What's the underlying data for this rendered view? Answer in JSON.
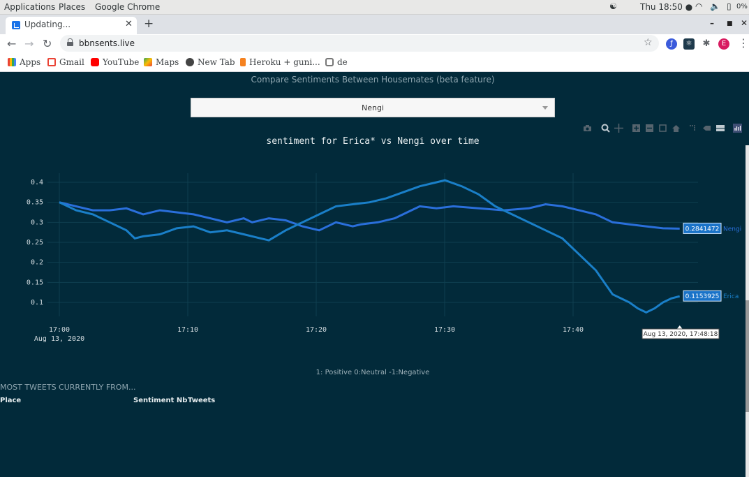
{
  "desktop": {
    "menus": [
      "Applications",
      "Places",
      "Google Chrome"
    ],
    "clock": "Thu 18:50 ●",
    "battery": "0%"
  },
  "browser": {
    "tab_title": "Updating...",
    "url": "bbnsents.live",
    "profile_initial": "E",
    "bookmarks": [
      "Apps",
      "Gmail",
      "YouTube",
      "Maps",
      "New Tab",
      "Heroku + guni...",
      "de"
    ]
  },
  "page": {
    "heading": "Compare Sentiments Between Housemates (beta feature)",
    "dropdown_value": "Nengi",
    "legend_note": "1: Positive 0:Neutral -1:Negative",
    "most_tweets_label": "MOST TWEETS CURRENTLY FROM...",
    "table_headers": [
      "Place",
      "Sentiment Nb",
      "Tweets"
    ]
  },
  "chart_data": {
    "type": "line",
    "title": "sentiment for Erica* vs Nengi over time",
    "xlabel": "",
    "ylabel": "",
    "x_ticks": [
      "17:00",
      "17:10",
      "17:20",
      "17:30",
      "17:40"
    ],
    "x_date_label": "Aug 13, 2020",
    "y_ticks": [
      "0.1",
      "0.15",
      "0.2",
      "0.25",
      "0.3",
      "0.35",
      "0.4"
    ],
    "ylim": [
      0.065,
      0.415
    ],
    "xlim_minutes": [
      0,
      50
    ],
    "series": [
      {
        "name": "Nengi",
        "color": "#2a6fdb",
        "end_label": "0.2841472",
        "points": [
          [
            0,
            0.35
          ],
          [
            2,
            0.34
          ],
          [
            4,
            0.33
          ],
          [
            6,
            0.33
          ],
          [
            8,
            0.335
          ],
          [
            10,
            0.32
          ],
          [
            12,
            0.33
          ],
          [
            14,
            0.325
          ],
          [
            16,
            0.32
          ],
          [
            18,
            0.31
          ],
          [
            19,
            0.305
          ],
          [
            20,
            0.3
          ],
          [
            21,
            0.305
          ],
          [
            22,
            0.31
          ],
          [
            23,
            0.3
          ],
          [
            25,
            0.31
          ],
          [
            27,
            0.305
          ],
          [
            29,
            0.29
          ],
          [
            31,
            0.28
          ],
          [
            33,
            0.3
          ],
          [
            35,
            0.29
          ],
          [
            36,
            0.295
          ],
          [
            38,
            0.3
          ],
          [
            40,
            0.31
          ],
          [
            41,
            0.32
          ],
          [
            42,
            0.33
          ],
          [
            43,
            0.34
          ],
          [
            45,
            0.335
          ],
          [
            47,
            0.34
          ],
          [
            50,
            0.335
          ],
          [
            53,
            0.33
          ],
          [
            56,
            0.335
          ],
          [
            58,
            0.345
          ],
          [
            60,
            0.34
          ],
          [
            62,
            0.33
          ],
          [
            64,
            0.32
          ],
          [
            66,
            0.3
          ],
          [
            68,
            0.295
          ],
          [
            70,
            0.29
          ],
          [
            72,
            0.285
          ],
          [
            74,
            0.2841472
          ]
        ]
      },
      {
        "name": "Erica",
        "color": "#1a7fc8",
        "end_label": "0.1153925",
        "points": [
          [
            0,
            0.35
          ],
          [
            2,
            0.33
          ],
          [
            4,
            0.32
          ],
          [
            6,
            0.3
          ],
          [
            8,
            0.28
          ],
          [
            9,
            0.26
          ],
          [
            10,
            0.265
          ],
          [
            12,
            0.27
          ],
          [
            14,
            0.285
          ],
          [
            16,
            0.29
          ],
          [
            18,
            0.275
          ],
          [
            20,
            0.28
          ],
          [
            22,
            0.27
          ],
          [
            24,
            0.26
          ],
          [
            25,
            0.255
          ],
          [
            27,
            0.28
          ],
          [
            29,
            0.3
          ],
          [
            31,
            0.32
          ],
          [
            33,
            0.34
          ],
          [
            35,
            0.345
          ],
          [
            37,
            0.35
          ],
          [
            39,
            0.36
          ],
          [
            41,
            0.375
          ],
          [
            43,
            0.39
          ],
          [
            45,
            0.4
          ],
          [
            46,
            0.405
          ],
          [
            48,
            0.39
          ],
          [
            50,
            0.37
          ],
          [
            52,
            0.34
          ],
          [
            54,
            0.32
          ],
          [
            56,
            0.3
          ],
          [
            58,
            0.28
          ],
          [
            60,
            0.26
          ],
          [
            62,
            0.22
          ],
          [
            64,
            0.18
          ],
          [
            65,
            0.15
          ],
          [
            66,
            0.12
          ],
          [
            68,
            0.1
          ],
          [
            69,
            0.085
          ],
          [
            70,
            0.075
          ],
          [
            71,
            0.085
          ],
          [
            72,
            0.1
          ],
          [
            73,
            0.11
          ],
          [
            74,
            0.1153925
          ]
        ]
      }
    ],
    "hover_label": "Aug 13, 2020, 17:48:18",
    "x_end_minutes": 48.3
  }
}
